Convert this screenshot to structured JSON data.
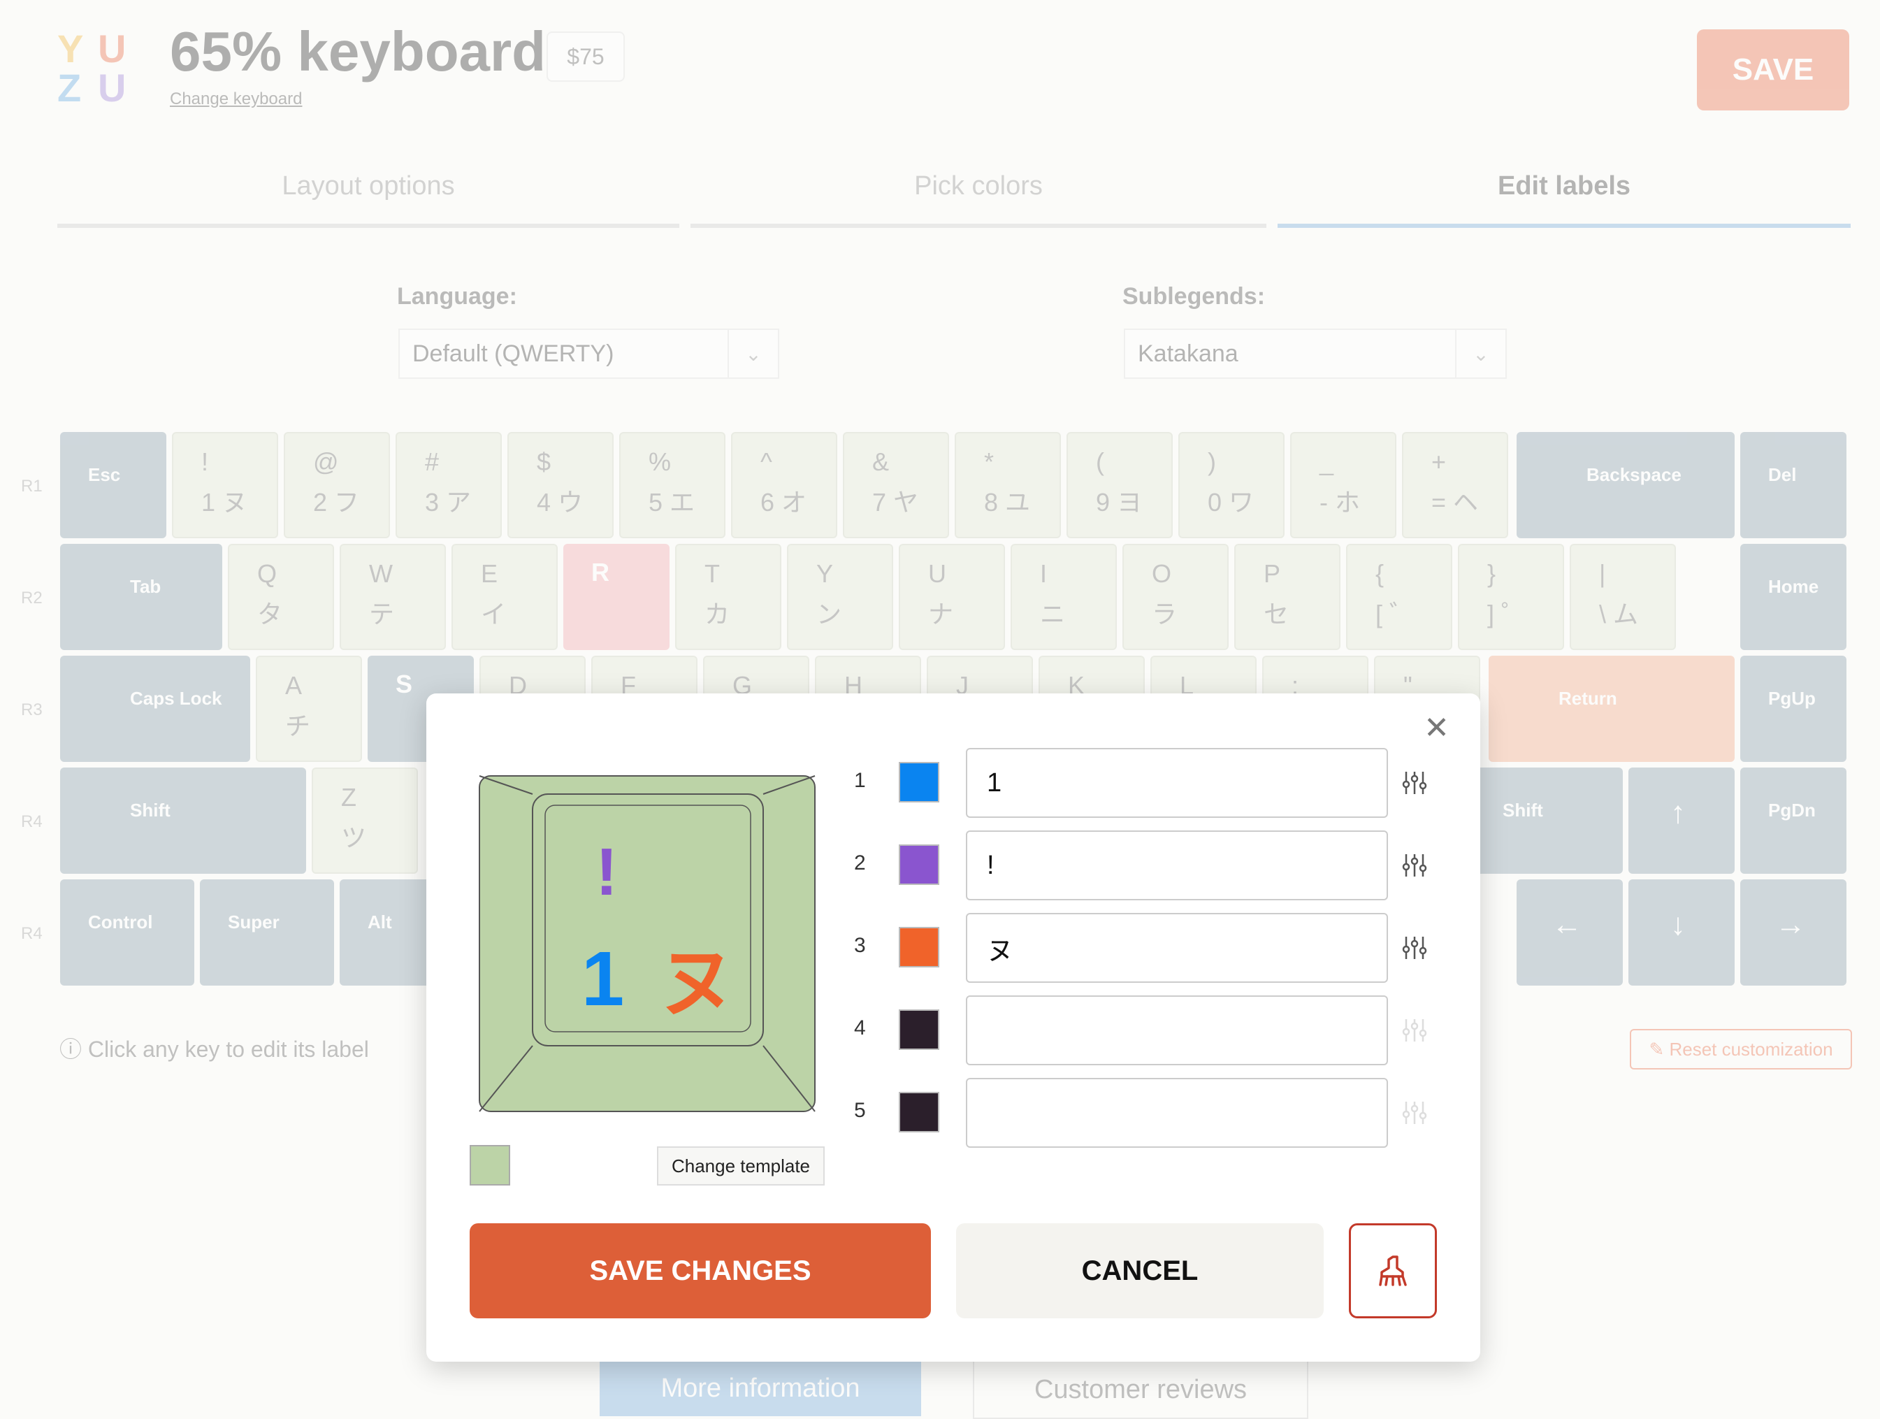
{
  "header": {
    "logo_letters": [
      "Y",
      "U",
      "Z",
      "U"
    ],
    "title": "65% keyboard",
    "price": "$75",
    "change_keyboard": "Change keyboard",
    "save": "SAVE"
  },
  "tabs": [
    {
      "label": "Layout options",
      "active": false
    },
    {
      "label": "Pick colors",
      "active": false
    },
    {
      "label": "Edit labels",
      "active": true
    }
  ],
  "options": {
    "language_label": "Language:",
    "language_value": "Default (QWERTY)",
    "sublegends_label": "Sublegends:",
    "sublegends_value": "Katakana"
  },
  "keyboard": {
    "rows": [
      "R1",
      "R2",
      "R3",
      "R4",
      "R4"
    ],
    "mod_keys": {
      "esc": "Esc",
      "backspace": "Backspace",
      "del": "Del",
      "tab": "Tab",
      "home": "Home",
      "caps": "Caps Lock",
      "return": "Return",
      "pgup": "PgUp",
      "shift_l": "Shift",
      "shift_r": "Shift",
      "pgdn": "PgDn",
      "control": "Control",
      "super": "Super",
      "alt": "Alt"
    },
    "r1": [
      [
        "!",
        "1 ヌ"
      ],
      [
        "@",
        "2 フ"
      ],
      [
        "#",
        "3 ア"
      ],
      [
        "$",
        "4 ウ"
      ],
      [
        "%",
        "5 エ"
      ],
      [
        "^",
        "6 オ"
      ],
      [
        "&",
        "7 ヤ"
      ],
      [
        "*",
        "8 ユ"
      ],
      [
        "(",
        "9 ヨ"
      ],
      [
        ")",
        "0 ワ"
      ],
      [
        "_",
        "- ホ"
      ],
      [
        "+",
        "= ヘ"
      ]
    ],
    "r2": [
      [
        "Q",
        "タ"
      ],
      [
        "W",
        "テ"
      ],
      [
        "E",
        "イ"
      ],
      [
        "R",
        ""
      ],
      [
        "T",
        "カ"
      ],
      [
        "Y",
        "ン"
      ],
      [
        "U",
        "ナ"
      ],
      [
        "I",
        "ニ"
      ],
      [
        "O",
        "ラ"
      ],
      [
        "P",
        "セ"
      ],
      [
        "{",
        "[ ゛"
      ],
      [
        "}",
        "] ゜"
      ],
      [
        "|",
        "\\ ム"
      ]
    ],
    "r3": [
      [
        "A",
        "チ"
      ],
      [
        "S",
        ""
      ],
      [
        "D",
        ""
      ],
      [
        "F",
        ""
      ],
      [
        "G",
        ""
      ],
      [
        "H",
        ""
      ],
      [
        "J",
        ""
      ],
      [
        "K",
        ""
      ],
      [
        "L",
        ""
      ],
      [
        ":",
        ""
      ],
      [
        "\"",
        ""
      ]
    ],
    "r4": [
      [
        "Z",
        "ツ"
      ]
    ]
  },
  "hint": "Click any key to edit its label",
  "reset": "Reset customization",
  "footer": {
    "more_info": "More information",
    "reviews": "Customer reviews"
  },
  "modal": {
    "preview": {
      "top_legend": "!",
      "main_legend": "1",
      "sub_legend": "ヌ",
      "keycap_color": "#bcd3a7"
    },
    "change_template": "Change template",
    "labels": [
      {
        "num": "1",
        "color": "#0a84f0",
        "value": "1"
      },
      {
        "num": "2",
        "color": "#8a55cf",
        "value": "!"
      },
      {
        "num": "3",
        "color": "#f0632a",
        "value": "ヌ"
      },
      {
        "num": "4",
        "color": "#2b1f2b",
        "value": ""
      },
      {
        "num": "5",
        "color": "#2b1f2b",
        "value": ""
      }
    ],
    "save_changes": "SAVE CHANGES",
    "cancel": "CANCEL"
  }
}
